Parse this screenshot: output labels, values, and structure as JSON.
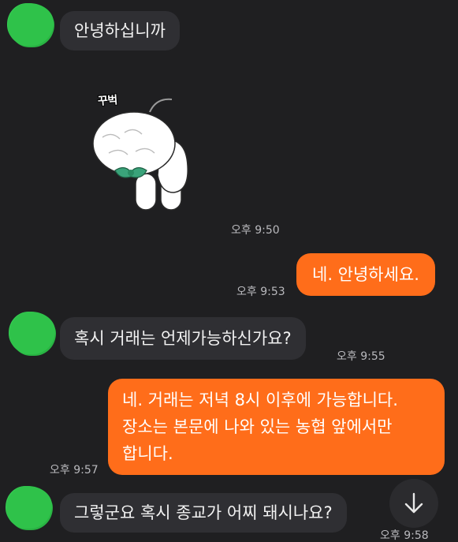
{
  "messages": [
    {
      "id": "m1",
      "direction": "incoming",
      "text": "안녕하십니까"
    },
    {
      "id": "m2",
      "direction": "incoming",
      "type": "sticker",
      "sticker_text": "꾸벅",
      "time": "오후 9:50"
    },
    {
      "id": "m3",
      "direction": "outgoing",
      "text": "네. 안녕하세요.",
      "time": "오후 9:53"
    },
    {
      "id": "m4",
      "direction": "incoming",
      "text": "혹시 거래는 언제가능하신가요?",
      "time": "오후 9:55"
    },
    {
      "id": "m5",
      "direction": "outgoing",
      "lines": [
        "네. 거래는 저녁 8시 이후에 가능합니다.",
        "장소는 본문에 나와 있는 농협 앞에서만",
        "합니다."
      ],
      "time": "오후 9:57"
    },
    {
      "id": "m6",
      "direction": "incoming",
      "text": "그렇군요 혹시 종교가 어찌 돼시나요?",
      "time": "오후 9:58"
    }
  ],
  "colors": {
    "background": "#1f1f21",
    "incoming_bubble": "#2f2f33",
    "outgoing_bubble": "#ff6d1a",
    "avatar": "#2fc24a",
    "timestamp": "#b9b9bd"
  },
  "icons": {
    "scroll_down": "arrow-down-icon",
    "sticker": "bowing-character-sticker"
  }
}
